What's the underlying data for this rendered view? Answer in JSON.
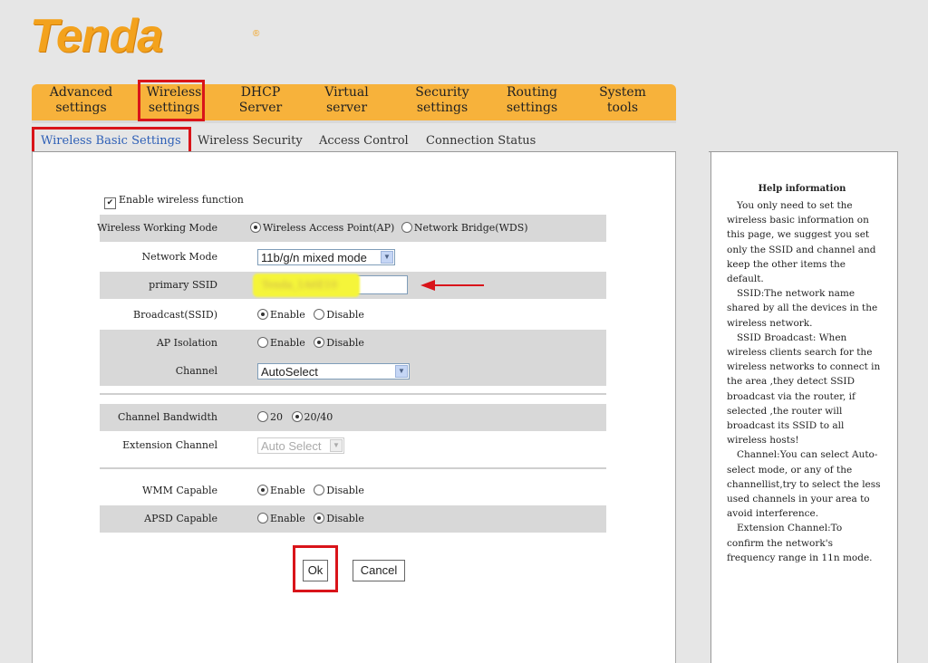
{
  "brand": {
    "logo_text": "Tenda",
    "registered_mark": "®"
  },
  "main_nav": [
    {
      "line1": "Advanced",
      "line2": "settings"
    },
    {
      "line1": "Wireless",
      "line2": "settings"
    },
    {
      "line1": "DHCP",
      "line2": "Server"
    },
    {
      "line1": "Virtual",
      "line2": "server"
    },
    {
      "line1": "Security",
      "line2": "settings"
    },
    {
      "line1": "Routing",
      "line2": "settings"
    },
    {
      "line1": "System",
      "line2": "tools"
    }
  ],
  "sub_nav": [
    "Wireless Basic Settings",
    "Wireless Security",
    "Access Control",
    "Connection Status"
  ],
  "form": {
    "enable_wireless_label": "Enable wireless function",
    "enable_wireless_checked": true,
    "working_mode": {
      "label": "Wireless Working Mode",
      "opt1": "Wireless Access Point(AP)",
      "opt2": "Network Bridge(WDS)",
      "selected": "opt1"
    },
    "network_mode": {
      "label": "Network Mode",
      "value": "11b/g/n mixed mode"
    },
    "primary_ssid": {
      "label": "primary SSID",
      "value": "Tenda_1A6E10"
    },
    "broadcast": {
      "label": "Broadcast(SSID)",
      "opt1": "Enable",
      "opt2": "Disable",
      "selected": "opt1"
    },
    "ap_isolation": {
      "label": "AP Isolation",
      "opt1": "Enable",
      "opt2": "Disable",
      "selected": "opt2"
    },
    "channel": {
      "label": "Channel",
      "value": "AutoSelect"
    },
    "channel_bandwidth": {
      "label": "Channel Bandwidth",
      "opt1": "20",
      "opt2": "20/40",
      "selected": "opt2"
    },
    "extension_channel": {
      "label": "Extension Channel",
      "value": "Auto Select"
    },
    "wmm": {
      "label": "WMM Capable",
      "opt1": "Enable",
      "opt2": "Disable",
      "selected": "opt1"
    },
    "apsd": {
      "label": "APSD Capable",
      "opt1": "Enable",
      "opt2": "Disable",
      "selected": "opt2"
    },
    "ok_label": "Ok",
    "cancel_label": "Cancel"
  },
  "help": {
    "title": "Help information",
    "paragraphs": [
      "You only need to set the wireless basic information on this page, we suggest you set only the SSID and channel and keep the other items the default.",
      "SSID:The network name shared by all the devices in the wireless network.",
      "SSID Broadcast: When wireless clients search for the wireless networks to connect in the area ,they detect SSID broadcast via the router, if selected ,the router will broadcast its SSID to all wireless hosts!",
      "Channel:You can select Auto-select mode, or any of the channellist,try to select the less used channels in your area to avoid interference.",
      "Extension Channel:To confirm the network's frequency range in 11n mode."
    ]
  },
  "colors": {
    "nav_orange": "#f7b23b",
    "logo_orange": "#f3a21d",
    "highlight_red": "#d9141a",
    "ssid_highlight": "#f5f53a",
    "active_subnav": "#2d5fb6"
  }
}
